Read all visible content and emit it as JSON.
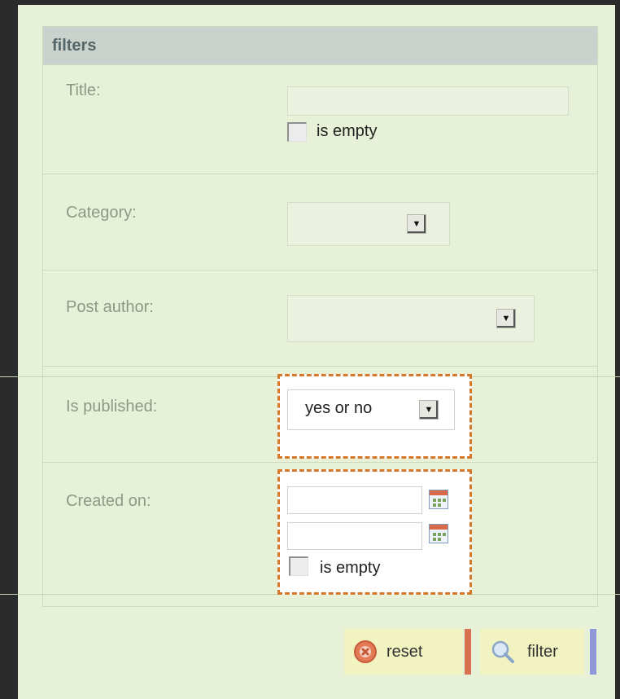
{
  "filters": {
    "title": "filters",
    "rows": [
      {
        "label": "Title:",
        "checkbox_label": "is empty"
      },
      {
        "label": "Category:",
        "selected": ""
      },
      {
        "label": "Post author:",
        "selected": ""
      },
      {
        "label": "Is published:",
        "selected": "yes or no"
      },
      {
        "label": "Created on:",
        "checkbox_label": "is empty"
      }
    ]
  },
  "actions": {
    "reset_label": "reset",
    "filter_label": "filter"
  },
  "colors": {
    "highlight_border": "#d4782c",
    "reset_edge": "#d9704f",
    "filter_edge": "#8f97d8"
  }
}
